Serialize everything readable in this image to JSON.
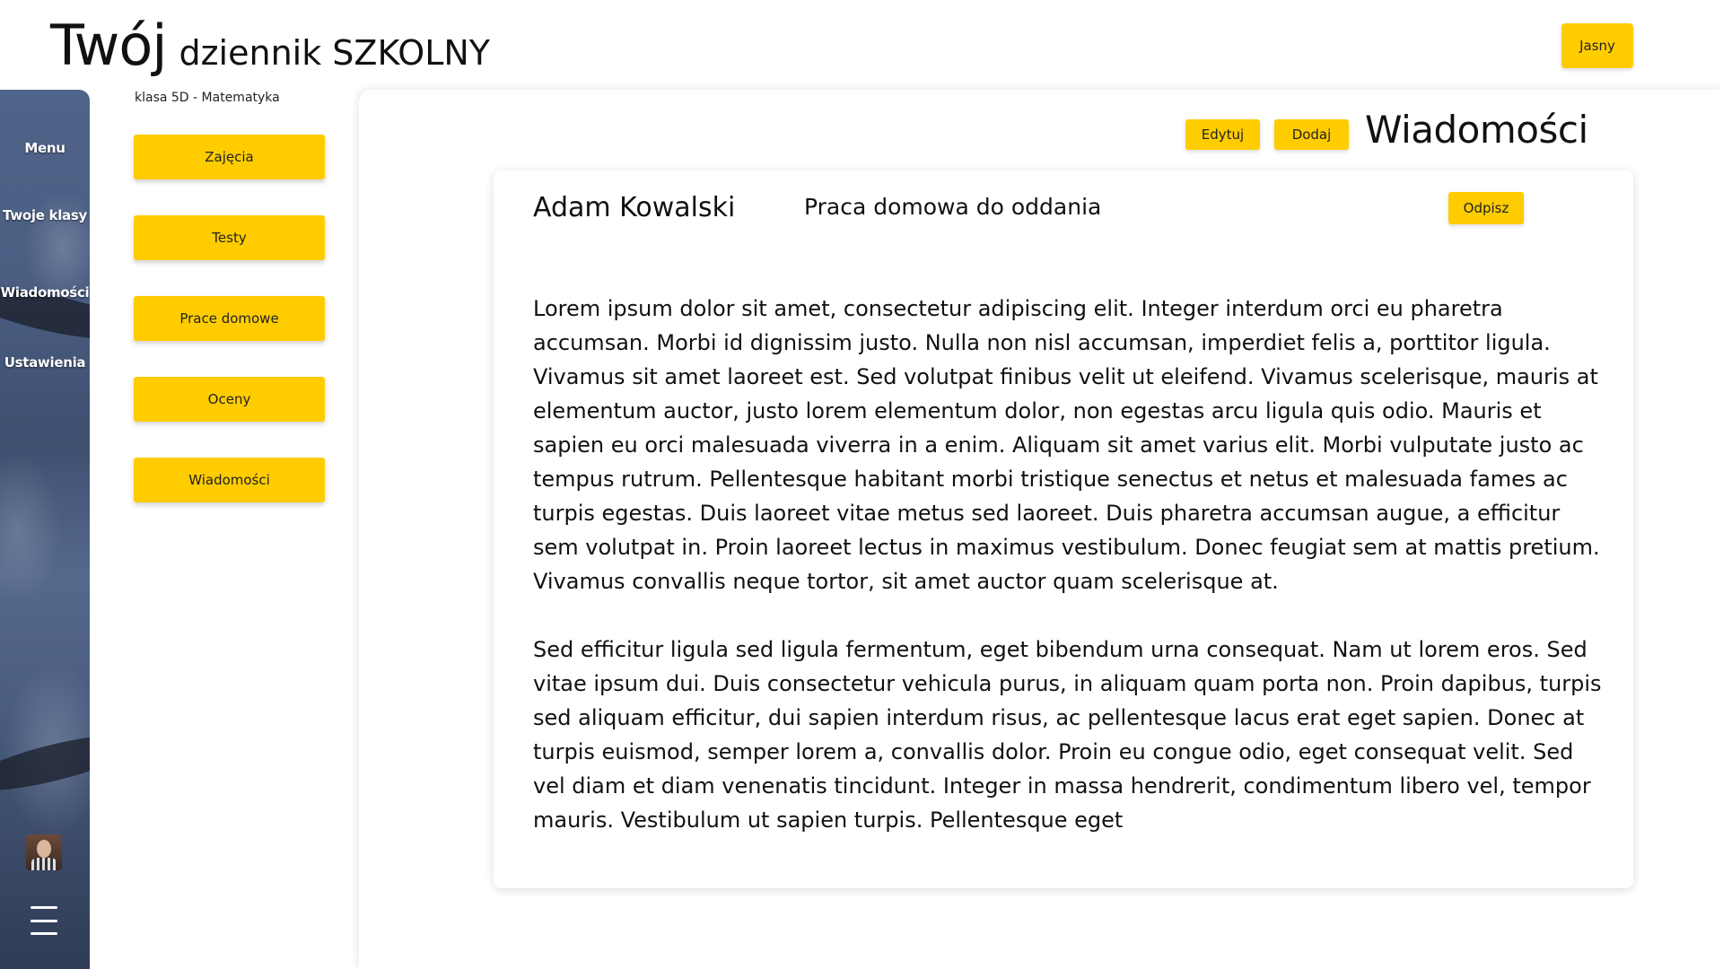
{
  "header": {
    "title_big": "Twój",
    "title_rest": "dziennik SZKOLNY",
    "theme_button": "Jasny"
  },
  "sidebar": {
    "items": [
      {
        "label": "Menu"
      },
      {
        "label": "Twoje klasy"
      },
      {
        "label": "Wiadomości"
      },
      {
        "label": "Ustawienia"
      }
    ],
    "avatar_icon": "user-avatar",
    "menu_icon": "hamburger-icon"
  },
  "class_menu": {
    "label": "klasa 5D - Matematyka",
    "items": [
      {
        "label": "Zajęcia"
      },
      {
        "label": "Testy"
      },
      {
        "label": "Prace domowe"
      },
      {
        "label": "Oceny"
      },
      {
        "label": "Wiadomości"
      }
    ]
  },
  "main": {
    "edit_button": "Edytuj",
    "add_button": "Dodaj",
    "title": "Wiadomości"
  },
  "message": {
    "sender": "Adam Kowalski",
    "subject": "Praca domowa do oddania",
    "reply_button": "Odpisz",
    "paragraphs": [
      "Lorem ipsum dolor sit amet, consectetur adipiscing elit. Integer interdum orci eu pharetra accumsan. Morbi id dignissim justo. Nulla non nisl accumsan, imperdiet felis a, porttitor ligula. Vivamus sit amet laoreet est. Sed volutpat finibus velit ut eleifend. Vivamus scelerisque, mauris at elementum auctor, justo lorem elementum dolor, non egestas arcu ligula quis odio. Mauris et sapien eu orci malesuada viverra in a enim. Aliquam sit amet varius elit. Morbi vulputate justo ac tempus rutrum. Pellentesque habitant morbi tristique senectus et netus et malesuada fames ac turpis egestas. Duis laoreet vitae metus sed laoreet. Duis pharetra accumsan augue, a efficitur sem volutpat in. Proin laoreet lectus in maximus vestibulum. Donec feugiat sem at mattis pretium. Vivamus convallis neque tortor, sit amet auctor quam scelerisque at.",
      "Sed efficitur ligula sed ligula fermentum, eget bibendum urna consequat. Nam ut lorem eros. Sed vitae ipsum dui. Duis consectetur vehicula purus, in aliquam quam porta non. Proin dapibus, turpis sed aliquam efficitur, dui sapien interdum risus, ac pellentesque lacus erat eget sapien. Donec at turpis euismod, semper lorem a, convallis dolor. Proin eu congue odio, eget consequat velit. Sed vel diam et diam venenatis tincidunt. Integer in massa hendrerit, condimentum libero vel, tempor mauris. Vestibulum ut sapien turpis. Pellentesque eget"
    ]
  },
  "colors": {
    "accent": "#ffcc00",
    "text": "#111111",
    "background": "#ffffff"
  }
}
